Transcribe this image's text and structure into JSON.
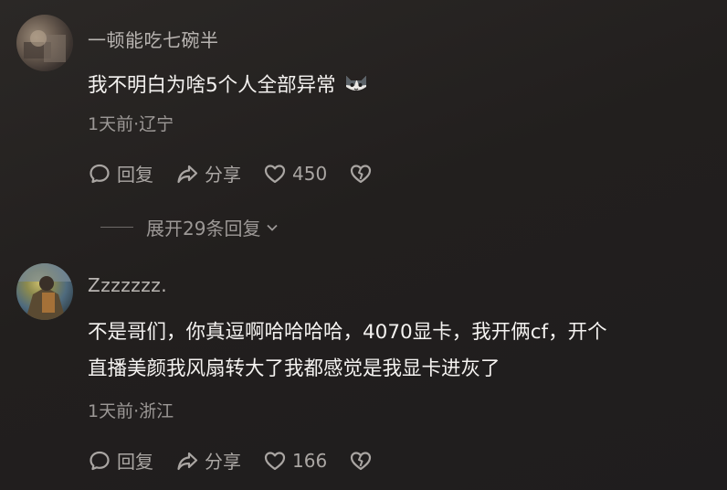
{
  "comments": [
    {
      "username": "一顿能吃七碗半",
      "content": "我不明白为啥5个人全部异常",
      "emoji_icon": "cat-emoji-icon",
      "meta": "1天前·辽宁",
      "reply_label": "回复",
      "share_label": "分享",
      "likes": "450",
      "expand_replies": "展开29条回复"
    },
    {
      "username": "Zzzzzzz.",
      "content_line1": "不是哥们，你真逗啊哈哈哈哈，4070显卡，我开俩cf，开个",
      "content_line2": "直播美颜我风扇转大了我都感觉是我显卡进灰了",
      "meta": "1天前·浙江",
      "reply_label": "回复",
      "share_label": "分享",
      "likes": "166"
    }
  ]
}
